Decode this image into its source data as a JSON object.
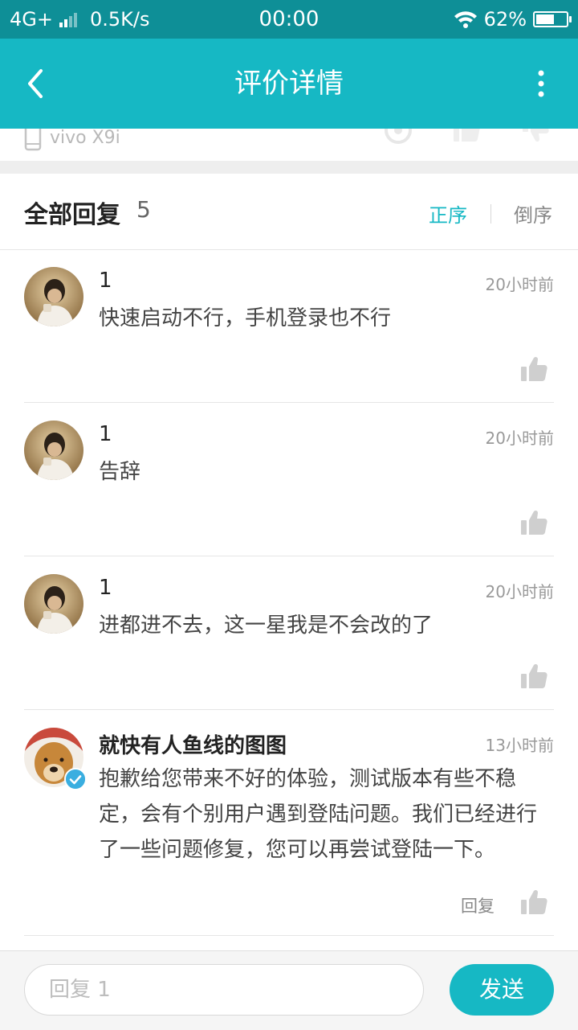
{
  "status_bar": {
    "network": "4G+",
    "speed": "0.5K/s",
    "time": "00:00",
    "battery": "62%",
    "battery_level": 0.62
  },
  "header": {
    "title": "评价详情",
    "back_icon": "chevron-left-icon",
    "more_icon": "more-vertical-icon"
  },
  "previous_card": {
    "device": "vivo X9i"
  },
  "replies_header": {
    "label": "全部回复",
    "count": "5",
    "sort_asc": "正序",
    "sort_desc": "倒序"
  },
  "replies": [
    {
      "user": "1",
      "time": "20小时前",
      "text": "快速启动不行，手机登录也不行"
    },
    {
      "user": "1",
      "time": "20小时前",
      "text": "告辞"
    },
    {
      "user": "1",
      "time": "20小时前",
      "text": "进都进不去，这一星我是不会改的了"
    },
    {
      "user": "就快有人鱼线的图图",
      "time": "13小时前",
      "text": "抱歉给您带来不好的体验，测试版本有些不稳定，会有个别用户遇到登陆问题。我们已经进行了一些问题修复，您可以再尝试登陆一下。",
      "reply_label": "回复",
      "verified": true
    }
  ],
  "reply_bar": {
    "placeholder": "回复 1",
    "send_label": "发送"
  },
  "colors": {
    "accent": "#16b8c4",
    "status_bar": "#0e8f97"
  }
}
